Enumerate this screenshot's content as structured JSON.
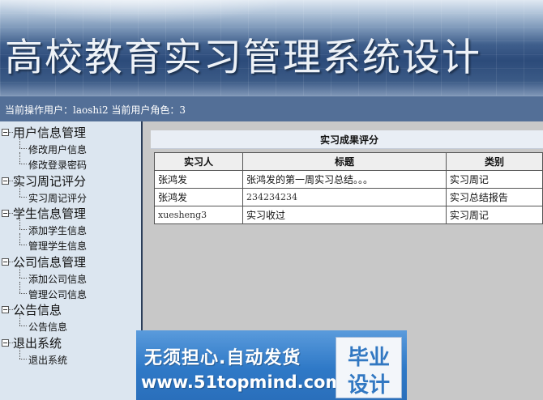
{
  "banner": {
    "title": "高校教育实习管理系统设计"
  },
  "userbar": {
    "text": "当前操作用户：laoshi2 当前用户角色：3"
  },
  "menu": {
    "groups": [
      {
        "label": "用户信息管理",
        "items": [
          "修改用户信息",
          "修改登录密码"
        ]
      },
      {
        "label": "实习周记评分",
        "items": [
          "实习周记评分"
        ]
      },
      {
        "label": "学生信息管理",
        "items": [
          "添加学生信息",
          "管理学生信息"
        ]
      },
      {
        "label": "公司信息管理",
        "items": [
          "添加公司信息",
          "管理公司信息"
        ]
      },
      {
        "label": "公告信息",
        "items": [
          "公告信息"
        ]
      },
      {
        "label": "退出系统",
        "items": [
          "退出系统"
        ]
      }
    ]
  },
  "main": {
    "panel_title": "实习成果评分",
    "table": {
      "headers": [
        "实习人",
        "标题",
        "类别"
      ],
      "rows": [
        [
          "张鸿发",
          "张鸿发的第一周实习总结。。。",
          "实习周记"
        ],
        [
          "张鸿发",
          "234234234",
          "实习总结报告"
        ],
        [
          "xuesheng3",
          "实习收过",
          "实习周记"
        ]
      ]
    }
  },
  "ad": {
    "line1": "无须担心.自动发货",
    "line2": "www.51topmind.com",
    "logo_top": "毕业",
    "logo_bottom": "设计"
  }
}
